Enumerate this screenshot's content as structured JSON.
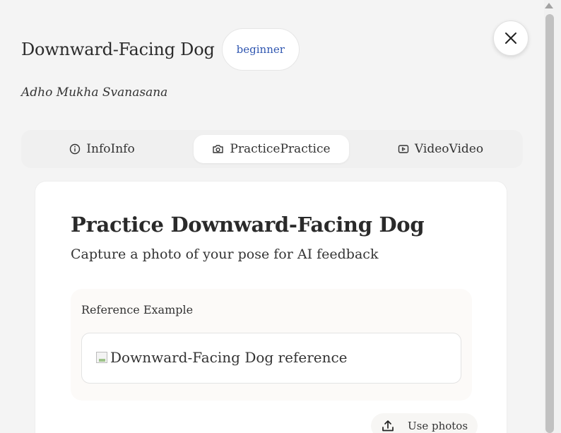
{
  "pose": {
    "title": "Downward-Facing Dog",
    "level": "beginner",
    "sanskrit": "Adho Mukha Svanasana"
  },
  "tabs": [
    {
      "label": "InfoInfo",
      "icon": "info-icon"
    },
    {
      "label": "PracticePractice",
      "icon": "camera-icon",
      "active": true
    },
    {
      "label": "VideoVideo",
      "icon": "video-icon"
    }
  ],
  "practice": {
    "title": "Practice Downward-Facing Dog",
    "subtitle": "Capture a photo of your pose for AI feedback",
    "reference_label": "Reference Example",
    "reference_alt": "Downward-Facing Dog reference",
    "use_photos_label": "Use photos"
  },
  "colors": {
    "badge_text": "#2f56b0",
    "background": "#f4f4f4",
    "card": "#ffffff"
  }
}
